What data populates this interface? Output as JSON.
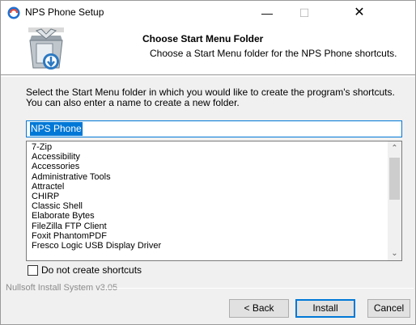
{
  "window": {
    "title": "NPS Phone Setup",
    "minimize_glyph": "—",
    "maximize_glyph": "☐",
    "close_glyph": "✕"
  },
  "header": {
    "title": "Choose Start Menu Folder",
    "subtitle": "Choose a Start Menu folder for the NPS Phone shortcuts.",
    "image_icon": "installer-box-icon"
  },
  "body": {
    "description": "Select the Start Menu folder in which you would like to create the program's shortcuts. You can also enter a name to create a new folder.",
    "folder_name_value": "NPS Phone",
    "folders": [
      "7-Zip",
      "Accessibility",
      "Accessories",
      "Administrative Tools",
      "Attractel",
      "CHIRP",
      "Classic Shell",
      "Elaborate Bytes",
      "FileZilla FTP Client",
      "Foxit PhantomPDF",
      "Fresco Logic USB Display Driver"
    ],
    "no_shortcuts_label": "Do not create shortcuts",
    "no_shortcuts_checked": false
  },
  "footer": {
    "branding": "Nullsoft Install System v3.05",
    "back_label": "< Back",
    "install_label": "Install",
    "cancel_label": "Cancel"
  },
  "colors": {
    "accent": "#0078d7",
    "dialog_bg": "#f0f0f0",
    "app_icon": "#1f6fd0"
  }
}
